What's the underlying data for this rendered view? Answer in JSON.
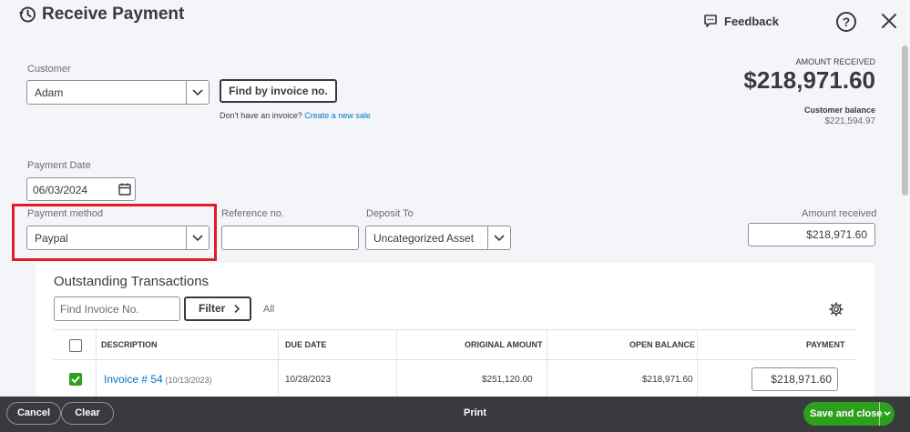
{
  "header": {
    "title": "Receive Payment",
    "feedback_label": "Feedback",
    "help_label": "?"
  },
  "customer": {
    "label": "Customer",
    "value": "Adam",
    "find_button": "Find by invoice no.",
    "no_invoice_text": "Don't have an invoice?",
    "create_link": "Create a new sale"
  },
  "summary": {
    "amount_received_label": "AMOUNT RECEIVED",
    "amount_received": "$218,971.60",
    "customer_balance_label": "Customer balance",
    "customer_balance": "$221,594.97"
  },
  "payment_date": {
    "label": "Payment Date",
    "value": "06/03/2024"
  },
  "payment_method": {
    "label": "Payment method",
    "value": "Paypal"
  },
  "reference": {
    "label": "Reference no.",
    "value": ""
  },
  "deposit": {
    "label": "Deposit To",
    "value": "Uncategorized Asset"
  },
  "amount_received_field": {
    "label": "Amount received",
    "value": "$218,971.60"
  },
  "outstanding": {
    "title": "Outstanding Transactions",
    "search_placeholder": "Find Invoice No.",
    "filter_label": "Filter",
    "all_label": "All",
    "columns": [
      "DESCRIPTION",
      "DUE DATE",
      "ORIGINAL AMOUNT",
      "OPEN BALANCE",
      "PAYMENT"
    ],
    "rows": [
      {
        "checked": true,
        "description": "Invoice # 54",
        "invoice_date": "(10/13/2023)",
        "due_date": "10/28/2023",
        "original_amount": "$251,120.00",
        "open_balance": "$218,971.60",
        "payment": "$218,971.60"
      }
    ]
  },
  "footer": {
    "cancel": "Cancel",
    "clear": "Clear",
    "print": "Print",
    "save_close": "Save and close"
  },
  "colors": {
    "accent_green": "#2ca01c",
    "link_blue": "#0077c5",
    "highlight_red": "#e11d24",
    "footer_bg": "#393a3d"
  }
}
